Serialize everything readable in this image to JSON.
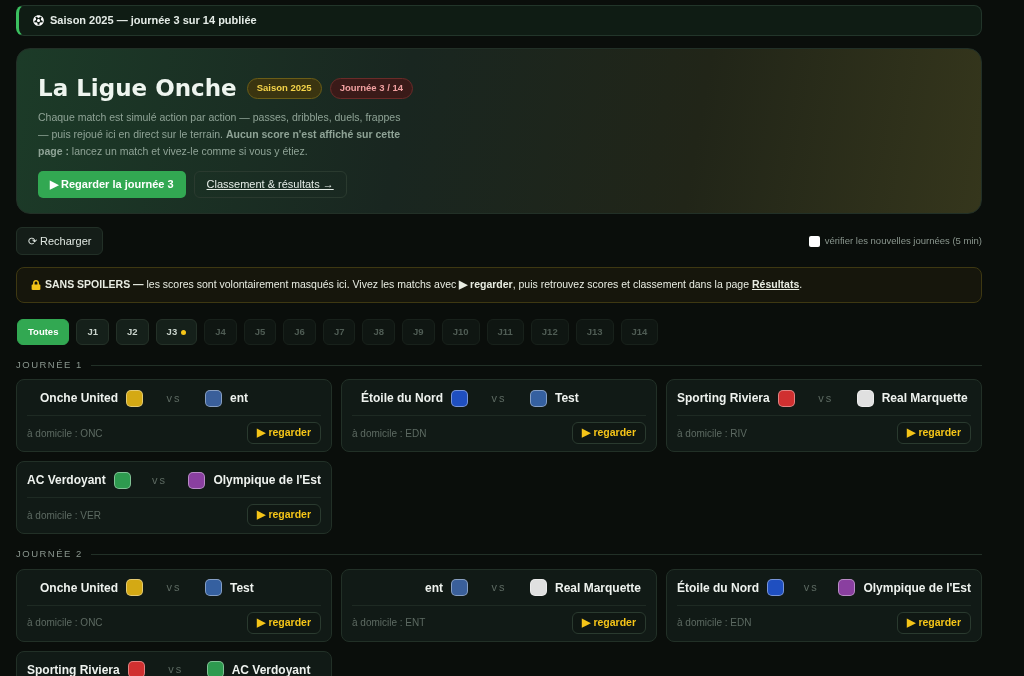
{
  "status_banner": {
    "text": "Saison 2025 — journée 3 sur 14 publiée"
  },
  "hero": {
    "title": "La Ligue Onche",
    "badges": [
      {
        "kind": "season",
        "label": "Saison 2025"
      },
      {
        "kind": "round",
        "label": "Journée 3 / 14"
      }
    ],
    "description": "Chaque match est simulé action par action — passes, dribbles, duels, frappes — puis rejoué ici en direct sur le terrain. **Aucun score n'est affiché sur cette page :** lancez un match et vivez-le comme si vous y étiez.",
    "primary_button": "▶ Regarder la journée 3",
    "secondary_link": "Classement & résultats →"
  },
  "toolbar": {
    "reload_button": "⟳ Recharger",
    "auto_check": {
      "label": "vérifier les nouvelles journées (5 min)",
      "checked": false
    }
  },
  "spoiler_notice": {
    "text": "**SANS SPOILERS —** les scores sont volontairement masqués ici. Vivez les matchs avec **▶ regarder**, puis retrouvez scores et classement dans la page ",
    "link": "Résultats",
    "after": "."
  },
  "round_tabs": [
    {
      "label": "Toutes",
      "selected": true,
      "available": true,
      "new": false
    },
    {
      "label": "J1",
      "selected": false,
      "available": true,
      "new": false
    },
    {
      "label": "J2",
      "selected": false,
      "available": true,
      "new": false
    },
    {
      "label": "J3",
      "selected": false,
      "available": true,
      "new": true
    },
    {
      "label": "J4",
      "selected": false,
      "available": false,
      "new": false
    },
    {
      "label": "J5",
      "selected": false,
      "available": false,
      "new": false
    },
    {
      "label": "J6",
      "selected": false,
      "available": false,
      "new": false
    },
    {
      "label": "J7",
      "selected": false,
      "available": false,
      "new": false
    },
    {
      "label": "J8",
      "selected": false,
      "available": false,
      "new": false
    },
    {
      "label": "J9",
      "selected": false,
      "available": false,
      "new": false
    },
    {
      "label": "J10",
      "selected": false,
      "available": false,
      "new": false
    },
    {
      "label": "J11",
      "selected": false,
      "available": false,
      "new": false
    },
    {
      "label": "J12",
      "selected": false,
      "available": false,
      "new": false
    },
    {
      "label": "J13",
      "selected": false,
      "available": false,
      "new": false
    },
    {
      "label": "J14",
      "selected": false,
      "available": false,
      "new": false
    }
  ],
  "rounds": [
    {
      "title": "JOURNÉE 1",
      "matches": [
        {
          "home": {
            "name": "Onche United",
            "color": "#d4a914"
          },
          "vs": "vs",
          "away": {
            "name": "ent",
            "color": "#3a5f9a"
          },
          "home_label": "à domicile : ONC",
          "watch": "▶ regarder"
        },
        {
          "home": {
            "name": "Étoile du Nord",
            "color": "#1f4fc0"
          },
          "vs": "vs",
          "away": {
            "name": "Test",
            "color": "#3560a0"
          },
          "home_label": "à domicile : EDN",
          "watch": "▶ regarder"
        },
        {
          "home": {
            "name": "Sporting Riviera",
            "color": "#d03030"
          },
          "vs": "vs",
          "away": {
            "name": "Real Marquette",
            "color": "#e0e0e0"
          },
          "home_label": "à domicile : RIV",
          "watch": "▶ regarder"
        },
        {
          "home": {
            "name": "AC Verdoyant",
            "color": "#2e9a4f"
          },
          "vs": "vs",
          "away": {
            "name": "Olympique de l'Est",
            "color": "#8a3fa0"
          },
          "home_label": "à domicile : VER",
          "watch": "▶ regarder"
        }
      ]
    },
    {
      "title": "JOURNÉE 2",
      "matches": [
        {
          "home": {
            "name": "Onche United",
            "color": "#d4a914"
          },
          "vs": "vs",
          "away": {
            "name": "Test",
            "color": "#3560a0"
          },
          "home_label": "à domicile : ONC",
          "watch": "▶ regarder"
        },
        {
          "home": {
            "name": "ent",
            "color": "#3a5f9a"
          },
          "vs": "vs",
          "away": {
            "name": "Real Marquette",
            "color": "#e0e0e0"
          },
          "home_label": "à domicile : ENT",
          "watch": "▶ regarder"
        },
        {
          "home": {
            "name": "Étoile du Nord",
            "color": "#1f4fc0"
          },
          "vs": "vs",
          "away": {
            "name": "Olympique de l'Est",
            "color": "#8a3fa0"
          },
          "home_label": "à domicile : EDN",
          "watch": "▶ regarder"
        },
        {
          "home": {
            "name": "Sporting Riviera",
            "color": "#d03030"
          },
          "vs": "vs",
          "away": {
            "name": "AC Verdoyant",
            "color": "#2e9a4f"
          }
        }
      ]
    }
  ]
}
